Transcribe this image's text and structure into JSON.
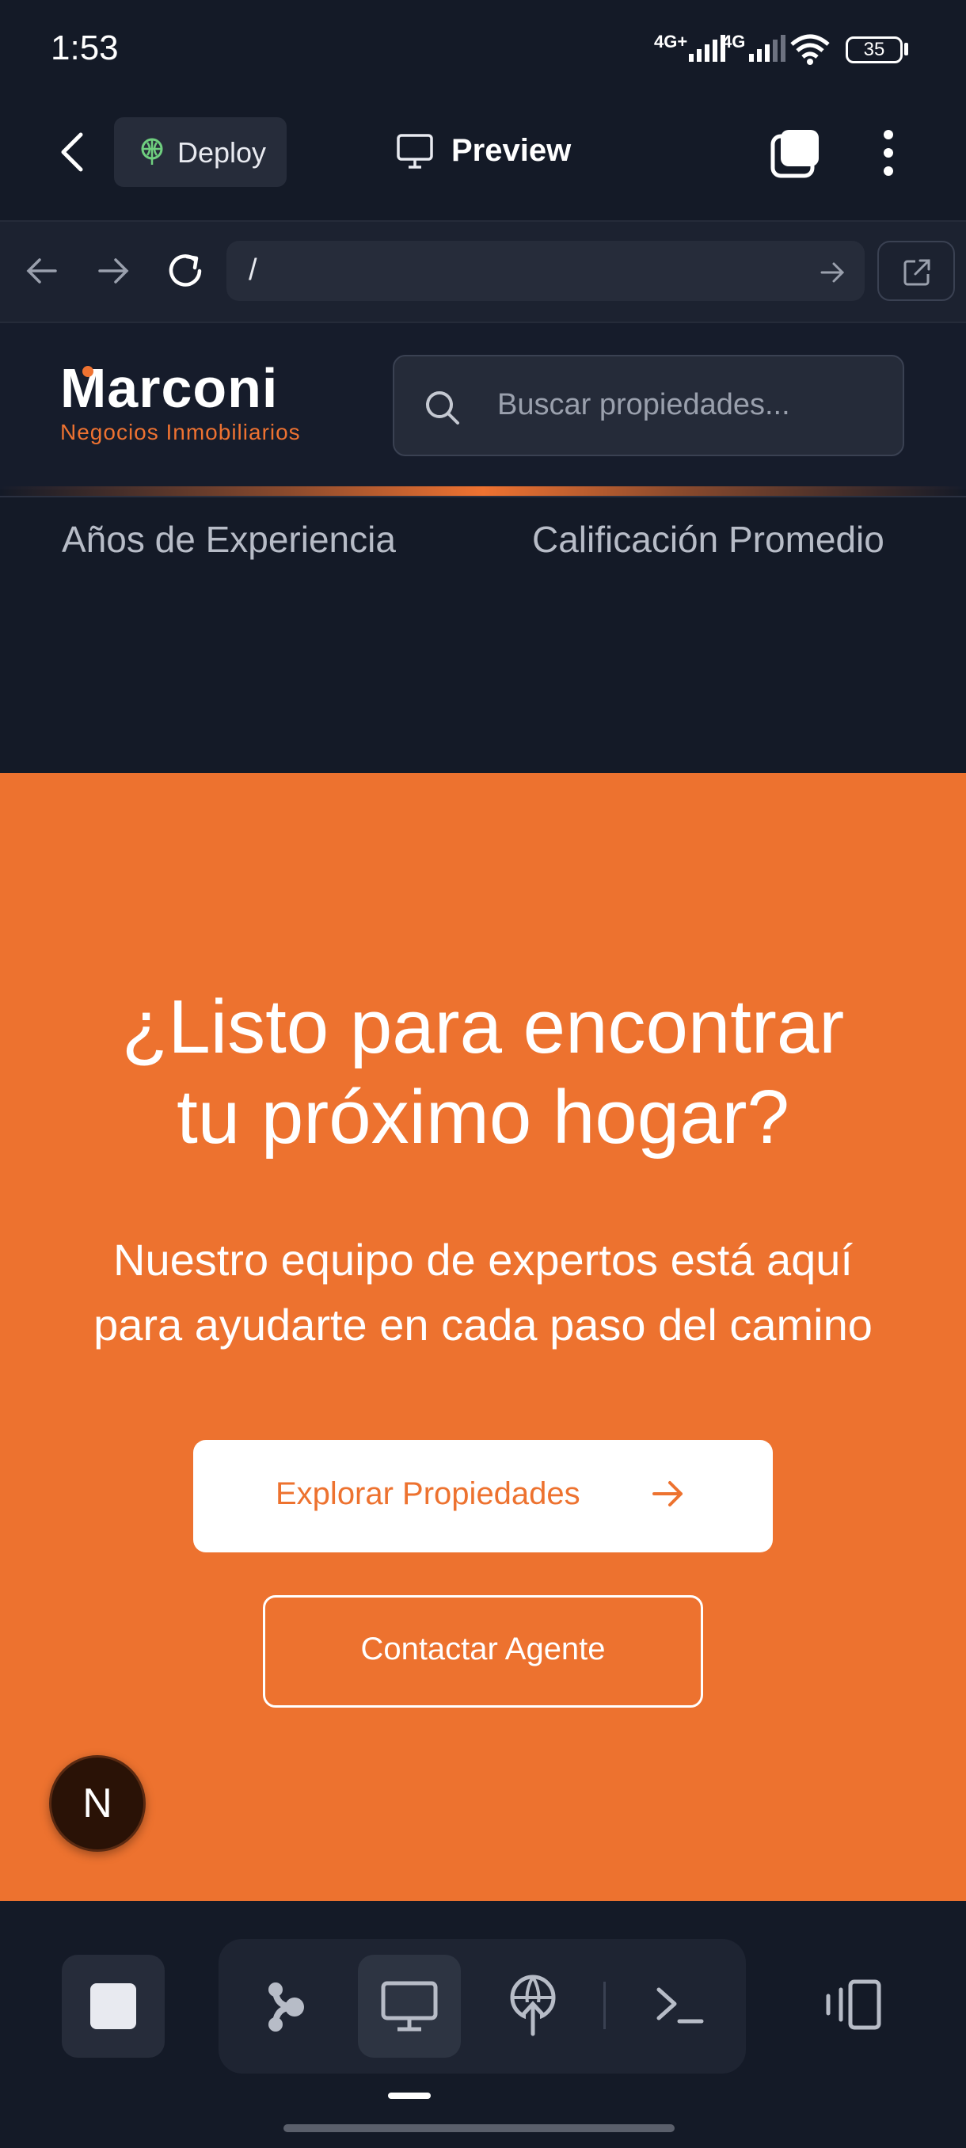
{
  "status_bar": {
    "time": "1:53",
    "network_1": "4G+",
    "network_2": "4G",
    "battery": "35"
  },
  "app_bar": {
    "deploy_label": "Deploy",
    "preview_label": "Preview"
  },
  "browser": {
    "url": "/"
  },
  "site": {
    "logo": "Marconi",
    "logo_subtitle": "Negocios Inmobiliarios",
    "search_placeholder": "Buscar propiedades...",
    "stats": {
      "years_label": "Años de Experiencia",
      "rating_label": "Calificación Promedio"
    },
    "cta": {
      "title_line1": "¿Listo para encontrar",
      "title_line2": "tu próximo hogar?",
      "subtitle_line1": "Nuestro equipo de expertos está aquí",
      "subtitle_line2": "para ayudarte en cada paso del camino",
      "explore_label": "Explorar Propiedades",
      "contact_label": "Contactar Agente"
    },
    "framework_badge": "N"
  },
  "colors": {
    "accent": "#ed722f",
    "background": "#141a27"
  },
  "icons": [
    "back-icon",
    "deploy-icon",
    "monitor-icon",
    "tabs-icon",
    "more-icon",
    "arrow-left-icon",
    "arrow-right-icon",
    "reload-icon",
    "external-link-icon",
    "search-icon",
    "arrow-right-icon",
    "stop-icon",
    "branch-icon",
    "monitor-icon",
    "globe-upload-icon",
    "terminal-icon",
    "device-icon"
  ]
}
